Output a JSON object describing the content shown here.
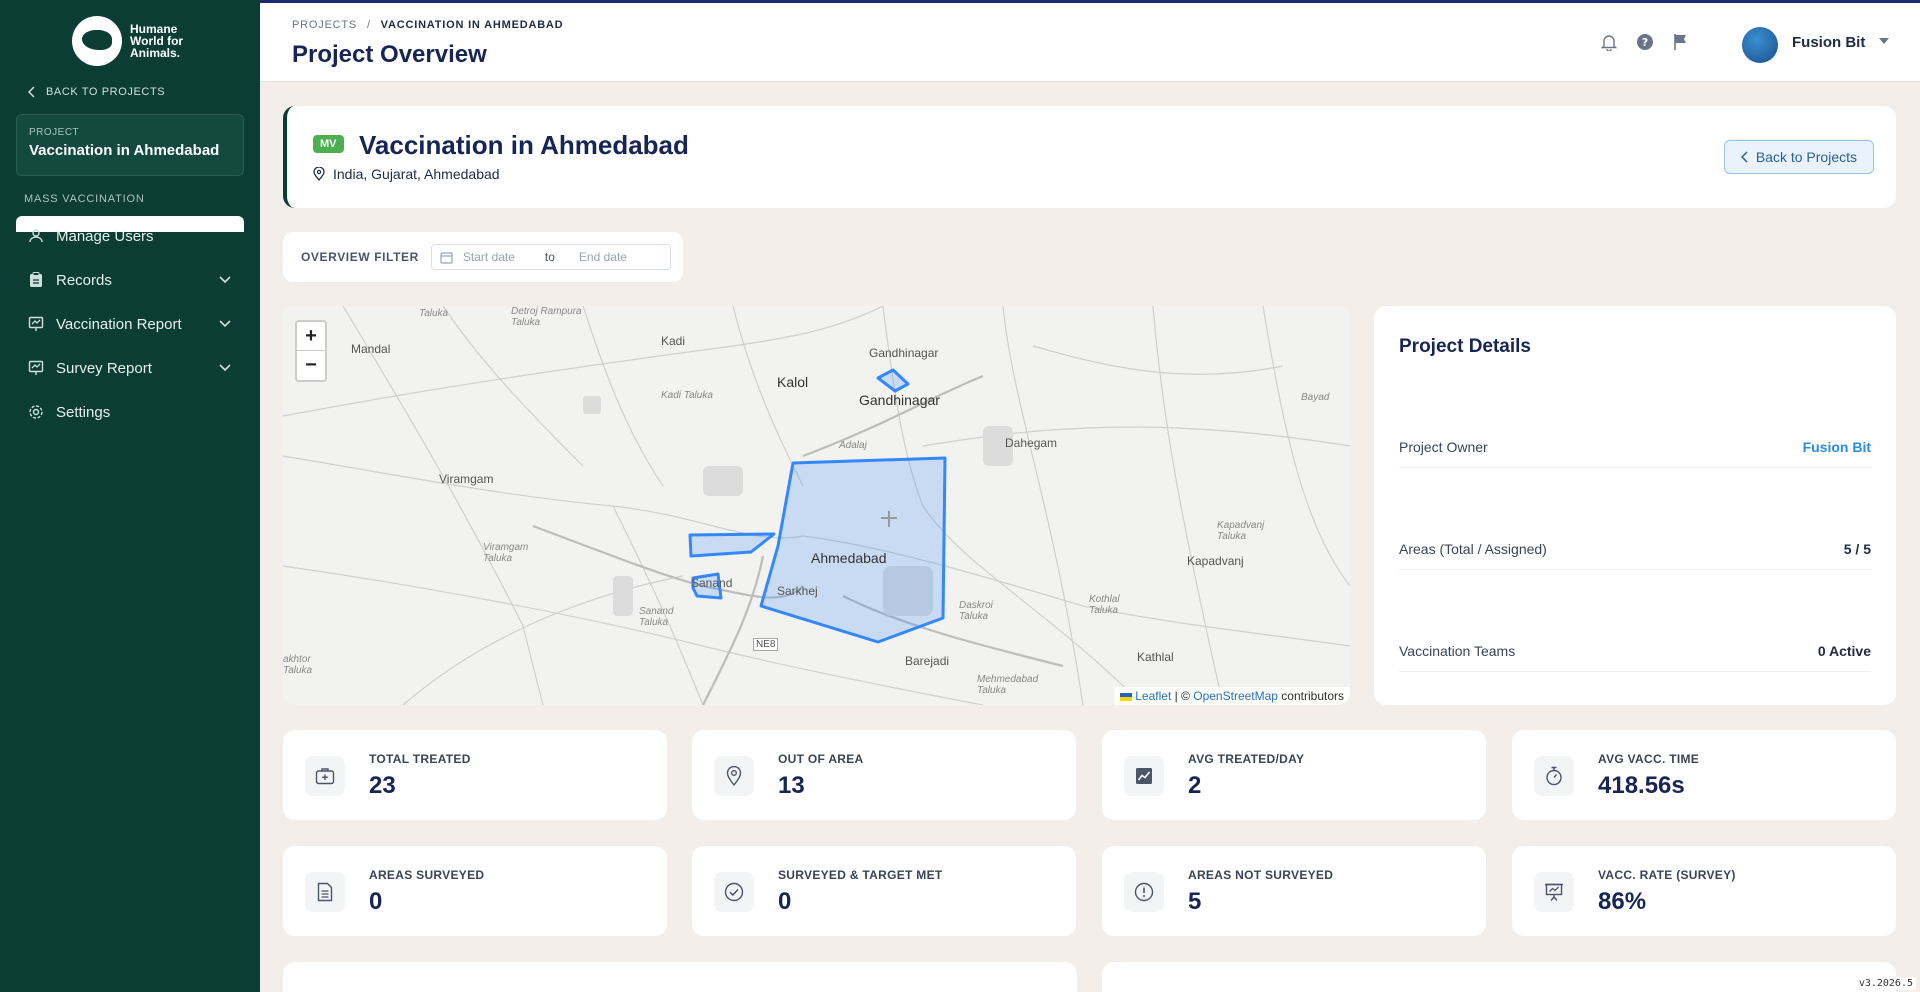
{
  "sidebar": {
    "logo": "Humane World for Animals",
    "logo_lines": [
      "Humane",
      "World for",
      "Animals."
    ],
    "back_label": "BACK TO PROJECTS",
    "project_label": "PROJECT",
    "project_name": "Vaccination in Ahmedabad",
    "section_label": "MASS VACCINATION",
    "items": [
      {
        "label": "Manage Users",
        "icon": "user-icon"
      },
      {
        "label": "Records",
        "icon": "clipboard-icon"
      },
      {
        "label": "Vaccination Report",
        "icon": "report-icon"
      },
      {
        "label": "Survey Report",
        "icon": "survey-icon"
      },
      {
        "label": "Settings",
        "icon": "gear-icon"
      }
    ]
  },
  "header": {
    "breadcrumb_root": "PROJECTS",
    "breadcrumb_sep": "/",
    "breadcrumb_current": "VACCINATION IN AHMEDABAD",
    "title": "Project Overview",
    "user_name": "Fusion Bit"
  },
  "banner": {
    "badge": "MV",
    "title": "Vaccination in Ahmedabad",
    "location": "India, Gujarat, Ahmedabad",
    "back_button": "Back to Projects"
  },
  "filter": {
    "label": "OVERVIEW FILTER",
    "start_placeholder": "Start date",
    "to": "to",
    "end_placeholder": "End date"
  },
  "map": {
    "zoom_in": "+",
    "zoom_out": "−",
    "attribution_leaflet": "Leaflet",
    "attribution_sep": " | © ",
    "attribution_osm": "OpenStreetMap",
    "attribution_tail": " contributors",
    "labels": [
      {
        "text": "Taluka",
        "cls": "it"
      },
      {
        "text": "Detroj Rampura Taluka",
        "cls": "it"
      },
      {
        "text": "Kadi",
        "cls": ""
      },
      {
        "text": "Gandhinagar",
        "cls": ""
      },
      {
        "text": "Mandal",
        "cls": ""
      },
      {
        "text": "Kalol",
        "cls": "big"
      },
      {
        "text": "Gandhinagar",
        "cls": "big"
      },
      {
        "text": "Kadi Taluka",
        "cls": "it"
      },
      {
        "text": "Bayad",
        "cls": ""
      },
      {
        "text": "Adalaj",
        "cls": ""
      },
      {
        "text": "Dahegam",
        "cls": ""
      },
      {
        "text": "Viramgam",
        "cls": ""
      },
      {
        "text": "Viramgam Taluka",
        "cls": "it"
      },
      {
        "text": "Ahmedabad",
        "cls": "big"
      },
      {
        "text": "Kapadvanj Taluka",
        "cls": "it"
      },
      {
        "text": "Kapadvanj",
        "cls": ""
      },
      {
        "text": "Sanand",
        "cls": ""
      },
      {
        "text": "Sarkhej",
        "cls": ""
      },
      {
        "text": "Sanand Taluka",
        "cls": "it"
      },
      {
        "text": "Daskroi Taluka",
        "cls": "it"
      },
      {
        "text": "Kothlal Taluka",
        "cls": "it"
      },
      {
        "text": "NE8",
        "cls": ""
      },
      {
        "text": "Barejadi",
        "cls": ""
      },
      {
        "text": "Mehmedabad Taluka",
        "cls": "it"
      },
      {
        "text": "Kathlal",
        "cls": ""
      },
      {
        "text": "akhtor Taluka",
        "cls": "it"
      }
    ]
  },
  "details": {
    "title": "Project Details",
    "rows": [
      {
        "label": "Project Owner",
        "value": "Fusion Bit"
      },
      {
        "label": "Areas (Total / Assigned)",
        "value": "5 / 5"
      },
      {
        "label": "Vaccination Teams",
        "value": "0 Active"
      }
    ]
  },
  "stats": [
    {
      "label": "TOTAL TREATED",
      "value": "23",
      "icon": "medkit-icon"
    },
    {
      "label": "OUT OF AREA",
      "value": "13",
      "icon": "pin-icon"
    },
    {
      "label": "AVG TREATED/DAY",
      "value": "2",
      "icon": "trend-chart-icon"
    },
    {
      "label": "AVG VACC. TIME",
      "value": "418.56s",
      "icon": "stopwatch-icon"
    },
    {
      "label": "AREAS SURVEYED",
      "value": "0",
      "icon": "document-icon"
    },
    {
      "label": "SURVEYED & TARGET MET",
      "value": "0",
      "icon": "check-circle-icon"
    },
    {
      "label": "AREAS NOT SURVEYED",
      "value": "5",
      "icon": "alert-circle-icon"
    },
    {
      "label": "VACC. RATE (SURVEY)",
      "value": "86%",
      "icon": "presentation-icon"
    }
  ],
  "version": "v3.2026.5"
}
